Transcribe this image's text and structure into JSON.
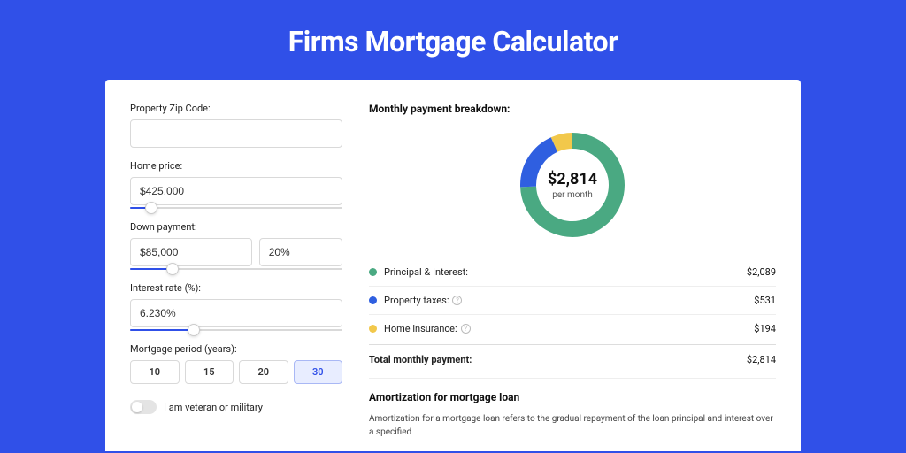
{
  "title": "Firms Mortgage Calculator",
  "form": {
    "zip_label": "Property Zip Code:",
    "zip_value": "",
    "home_price_label": "Home price:",
    "home_price_value": "$425,000",
    "home_price_slider_pct": 10,
    "down_payment_label": "Down payment:",
    "down_payment_value": "$85,000",
    "down_payment_pct_value": "20%",
    "down_payment_slider_pct": 20,
    "interest_label": "Interest rate (%):",
    "interest_value": "6.230%",
    "interest_slider_pct": 30,
    "period_label": "Mortgage period (years):",
    "periods": [
      "10",
      "15",
      "20",
      "30"
    ],
    "period_selected": "30",
    "veteran_label": "I am veteran or military",
    "veteran_on": false
  },
  "breakdown": {
    "heading": "Monthly payment breakdown:",
    "center_amount": "$2,814",
    "center_sub": "per month",
    "items": [
      {
        "label": "Principal & Interest:",
        "value": "$2,089",
        "color": "#4aa982",
        "info": false
      },
      {
        "label": "Property taxes:",
        "value": "$531",
        "color": "#2f5fe0",
        "info": true
      },
      {
        "label": "Home insurance:",
        "value": "$194",
        "color": "#f2c84b",
        "info": true
      }
    ],
    "total_label": "Total monthly payment:",
    "total_value": "$2,814"
  },
  "chart_data": {
    "type": "pie",
    "title": "Monthly payment breakdown",
    "series": [
      {
        "name": "Principal & Interest",
        "value": 2089,
        "color": "#4aa982"
      },
      {
        "name": "Property taxes",
        "value": 531,
        "color": "#2f5fe0"
      },
      {
        "name": "Home insurance",
        "value": 194,
        "color": "#f2c84b"
      }
    ],
    "total": 2814,
    "center_label": "$2,814 per month"
  },
  "amortization": {
    "heading": "Amortization for mortgage loan",
    "text": "Amortization for a mortgage loan refers to the gradual repayment of the loan principal and interest over a specified"
  }
}
